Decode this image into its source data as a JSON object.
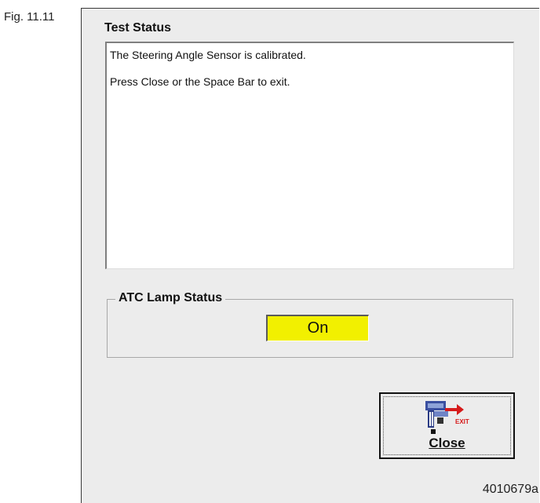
{
  "figure_label": "Fig. 11.11",
  "test_status": {
    "title": "Test Status",
    "lines": [
      "The Steering Angle Sensor is calibrated.",
      "Press Close or the Space Bar to exit."
    ]
  },
  "atc_lamp": {
    "group_title": "ATC Lamp Status",
    "value": "On",
    "indicator_color": "#f2f000"
  },
  "close_button": {
    "label": "Close",
    "icon": "exit-door-icon",
    "icon_text": "EXIT"
  },
  "reference_number": "4010679a"
}
